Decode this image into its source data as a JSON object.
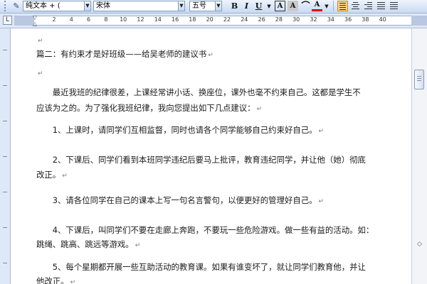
{
  "toolbar": {
    "style_value": "纯文本 + (",
    "font_value": "宋体",
    "size_value": "五号",
    "bold_label": "B",
    "italic_label": "I",
    "underline_label": "U",
    "charbox_label": "A",
    "charshade_label": "A",
    "font_color_label": "A"
  },
  "ruler": {
    "corner_label": "L",
    "numbers": [
      "2",
      "4",
      "6",
      "8",
      "10",
      "12",
      "14",
      "16",
      "18",
      "20",
      "22",
      "24",
      "26",
      "28",
      "30",
      "32",
      "34",
      "36",
      "38",
      "40"
    ]
  },
  "document": {
    "paragraph_mark": "↵",
    "lines": [
      "",
      "篇二：有约束才是好班级——给吴老师的建议书",
      "",
      "　　最近我班的纪律很差，上课经常讲小话、换座位，课外也毫不约束自己。这都是学生不",
      "应该为之的。为了强化我班纪律，我向您提出如下几点建议：",
      "　　1、上课时，请同学们互相监督，同时也请各个同学能够自己约束好自己。",
      "　　2、下课后、同学们看到本班同学违纪后要马上批评，教育违纪同学，并让他（她）彻底",
      "改正。",
      "　　3、请各位同学在自己的课本上写一句名言警句，以便更好的管理好自己。",
      "　　4、下课后，叫同学们不要在走廊上奔跑，不要玩一些危险游戏。做一些有益的活动。如：",
      "跳绳、跳高、跳远等游戏。",
      "　　5、每个星期都开展一些互助活动的教育课。如果有谁变坏了，就让同学们教育他，并让",
      "他改正。"
    ]
  }
}
